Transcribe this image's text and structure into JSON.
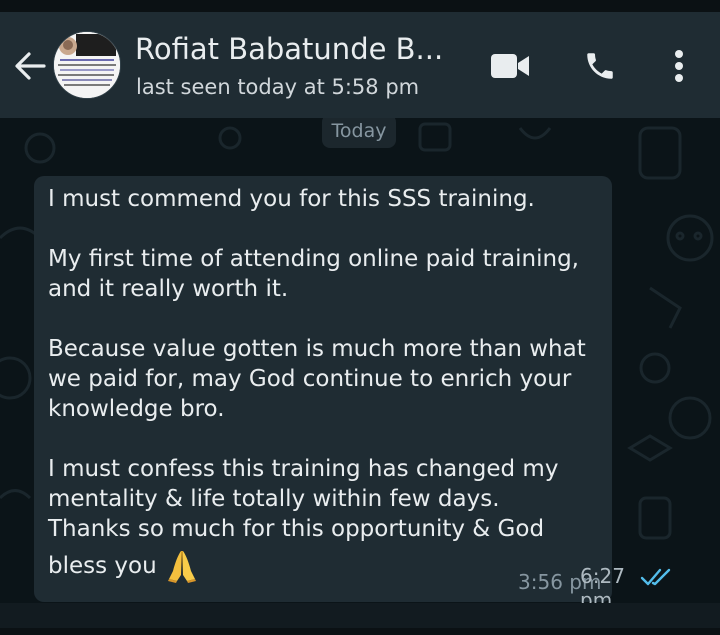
{
  "header": {
    "contact_name": "Rofiat Babatunde B...",
    "status": "last seen today at 5:58 pm",
    "back_icon": "arrow-left-icon",
    "video_icon": "video-camera-icon",
    "call_icon": "phone-icon",
    "menu_icon": "more-vertical-icon"
  },
  "chat": {
    "date_label": "Today",
    "message": {
      "paragraphs": [
        "I must commend you for this SSS training.",
        "My first time of attending online paid training,\nand it really worth it.",
        "Because value gotten is much more than what\nwe paid for, may God continue to enrich your\nknowledge bro.",
        "I must confess this training has changed my\nmentality & life totally within few days.\nThanks so much for this opportunity & God"
      ],
      "last_line": "bless you",
      "emoji": "🙏",
      "time_behind": "3:56 pm",
      "time": "6:27 pm",
      "status_icon": "double-check-icon"
    }
  },
  "colors": {
    "header_bg": "#1f2c33",
    "bubble_bg": "#1f2c33",
    "chat_bg": "#0b1418",
    "read_tick": "#53bdeb"
  }
}
